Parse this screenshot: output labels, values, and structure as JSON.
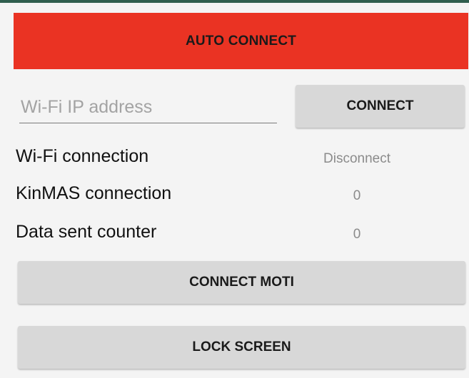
{
  "auto_connect": {
    "label": "AUTO CONNECT",
    "color": "#ea3323"
  },
  "wifi_ip": {
    "placeholder": "Wi-Fi IP address",
    "value": ""
  },
  "connect_button": {
    "label": "CONNECT"
  },
  "status": {
    "wifi": {
      "label": "Wi-Fi connection",
      "value": "Disconnect"
    },
    "kinmas": {
      "label": "KinMAS connection",
      "value": "0"
    },
    "data_sent": {
      "label": "Data sent counter",
      "value": "0"
    }
  },
  "connect_moti_button": {
    "label": "CONNECT MOTI"
  },
  "lock_screen_button": {
    "label": "LOCK SCREEN"
  }
}
